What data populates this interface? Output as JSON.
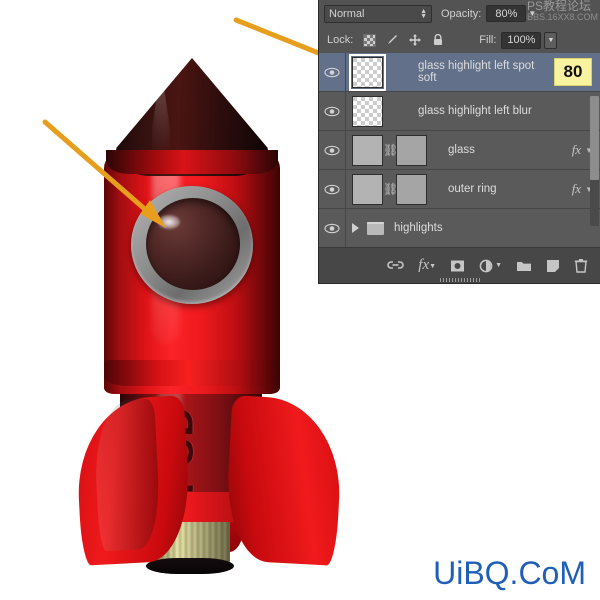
{
  "panel": {
    "blend_mode": "Normal",
    "opacity_label": "Opacity:",
    "opacity_value": "80%",
    "lock_label": "Lock:",
    "fill_label": "Fill:",
    "fill_value": "100%",
    "lock_icons": [
      "transparency-checker-icon",
      "brush-icon",
      "move-icon",
      "lock-icon"
    ],
    "watermark_line1": "PS教程论坛",
    "watermark_line2": "BBS.16XX8.COM",
    "layers": [
      {
        "name": "glass highlight left spot soft",
        "visible": true,
        "selected": true,
        "thumb": "transparent",
        "has_mask": false,
        "has_fx": false,
        "badge": "80",
        "type": "layer"
      },
      {
        "name": "glass highlight left blur",
        "visible": true,
        "selected": false,
        "thumb": "transparent",
        "has_mask": false,
        "has_fx": false,
        "badge": "",
        "type": "layer"
      },
      {
        "name": "glass",
        "visible": true,
        "selected": false,
        "thumb": "solid",
        "has_mask": true,
        "has_fx": true,
        "badge": "",
        "type": "layer"
      },
      {
        "name": "outer ring",
        "visible": true,
        "selected": false,
        "thumb": "solid",
        "has_mask": true,
        "has_fx": true,
        "badge": "",
        "type": "layer"
      },
      {
        "name": "highlights",
        "visible": true,
        "selected": false,
        "thumb": "none",
        "has_mask": false,
        "has_fx": false,
        "badge": "",
        "type": "group"
      }
    ],
    "bottom_tools": [
      "link-layers-icon",
      "add-layer-style-icon",
      "add-layer-mask-icon",
      "adjustment-layer-icon",
      "new-group-icon",
      "new-layer-icon",
      "delete-layer-icon"
    ]
  },
  "canvas": {
    "rocket_label": "PSD",
    "watermark": "UiBQ.CoM",
    "annotation_arrows": 2
  },
  "colors": {
    "panel_bg": "#535353",
    "row_bg": "#5a5a5a",
    "row_selected": "#62708a",
    "arrow": "#e79e1c",
    "badge": "#f7f3a0",
    "watermark_blue": "#1f5fb8",
    "rocket_red": "#f0191d",
    "rocket_dark": "#2a0608"
  }
}
